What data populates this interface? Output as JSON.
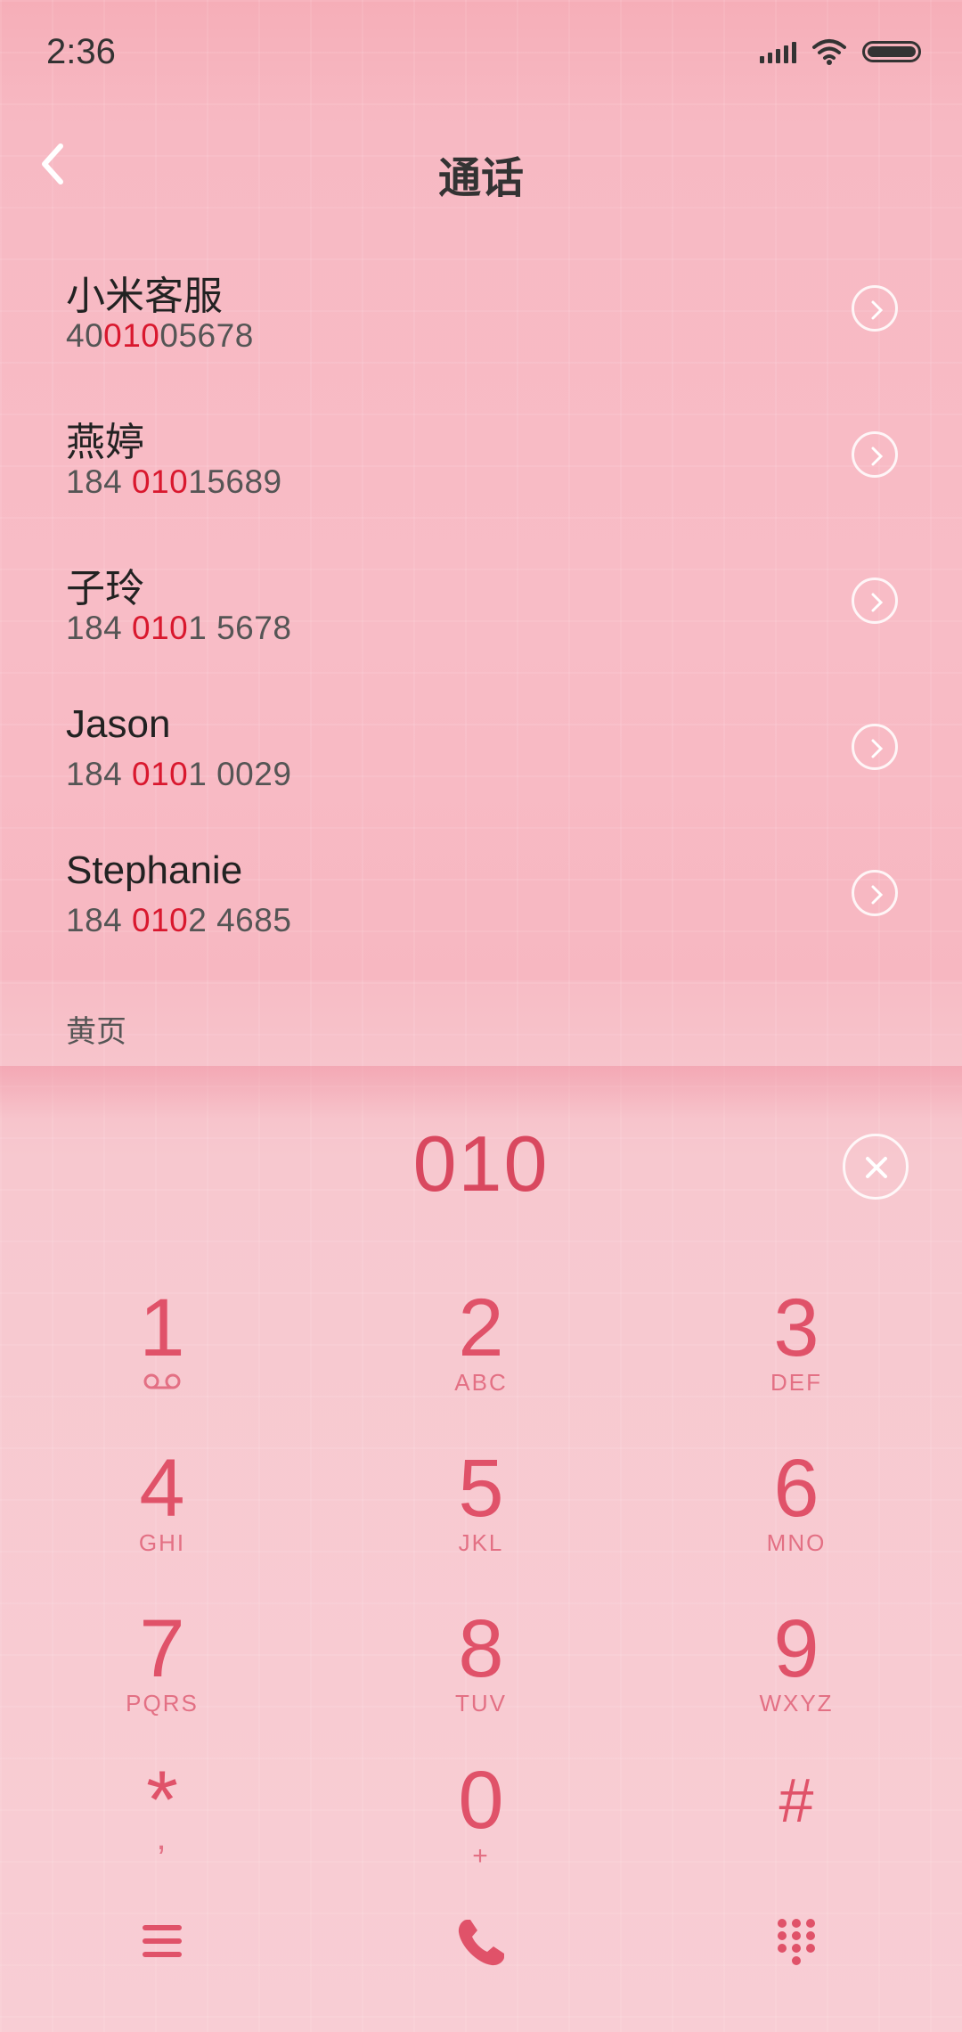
{
  "status_bar": {
    "time": "2:36"
  },
  "header": {
    "title": "通话"
  },
  "contacts": [
    {
      "name": "小米客服",
      "number_pre": "40",
      "number_match": "010",
      "number_post": "05678"
    },
    {
      "name": "燕婷",
      "number_pre": "184 ",
      "number_match": "010",
      "number_post": "15689"
    },
    {
      "name": "子玲",
      "number_pre": "184 ",
      "number_match": "010",
      "number_post": "1 5678"
    },
    {
      "name": "Jason",
      "number_pre": "184 ",
      "number_match": "010",
      "number_post": "1 0029"
    },
    {
      "name": "Stephanie",
      "number_pre": "184 ",
      "number_match": "010",
      "number_post": "2 4685"
    }
  ],
  "yellow_pages": {
    "label": "黄页"
  },
  "dialer": {
    "input": "010"
  },
  "keypad": {
    "keys": [
      {
        "digit": "1",
        "letters": ""
      },
      {
        "digit": "2",
        "letters": "ABC"
      },
      {
        "digit": "3",
        "letters": "DEF"
      },
      {
        "digit": "4",
        "letters": "GHI"
      },
      {
        "digit": "5",
        "letters": "JKL"
      },
      {
        "digit": "6",
        "letters": "MNO"
      },
      {
        "digit": "7",
        "letters": "PQRS"
      },
      {
        "digit": "8",
        "letters": "TUV"
      },
      {
        "digit": "9",
        "letters": "WXYZ"
      },
      {
        "digit": "*",
        "letters": ","
      },
      {
        "digit": "0",
        "letters": "+"
      },
      {
        "digit": "#",
        "letters": ""
      }
    ]
  },
  "icons": {
    "back": "chevron-left-icon",
    "detail": "chevron-right-circle-icon",
    "clear": "close-circle-icon",
    "voicemail": "voicemail-icon",
    "menu": "menu-icon",
    "call": "phone-icon",
    "keypad": "dialpad-icon"
  },
  "colors": {
    "accent": "#e05269",
    "match_highlight": "#d9182e",
    "background": "#f7c3cc"
  }
}
